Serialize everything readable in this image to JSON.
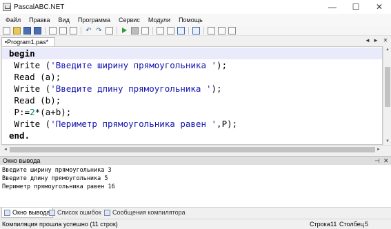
{
  "window": {
    "title": "PascalABC.NET",
    "minimize": "—",
    "maximize": "☐",
    "close": "✕"
  },
  "menu": [
    "Файл",
    "Правка",
    "Вид",
    "Программа",
    "Сервис",
    "Модули",
    "Помощь"
  ],
  "editor_tab": {
    "label": "•Program1.pas*",
    "prev": "◄",
    "next": "►",
    "close": "✕"
  },
  "code": {
    "l1_kw": "begin",
    "l2_fn": " Write (",
    "l2_str": "'Введите ширину прямоугольника '",
    "l2_end": ");",
    "l3": " Read (a);",
    "l4_fn": " Write (",
    "l4_str": "'Введите длину прямоугольника '",
    "l4_end": ");",
    "l5": " Read (b);",
    "l6_a": " P:=",
    "l6_num": "2",
    "l6_b": "*(a+b);",
    "l7_fn": " Write (",
    "l7_str": "'Периметр прямоугольника равен '",
    "l7_end": ",P);",
    "l8_kw": "end."
  },
  "output_panel": {
    "title": "Окно вывода",
    "pin": "⊣",
    "close": "✕"
  },
  "output_lines": [
    "Введите ширину прямоугольника 3",
    "Введите длину прямоугольника 5",
    "Периметр прямоугольника равен 16"
  ],
  "bottom_tabs": {
    "output": "Окно вывода",
    "errors": "Список ошибок",
    "compiler": "Сообщения компилятора"
  },
  "status": {
    "message": "Компиляция прошла успешно (11 строк)",
    "row_label": "Строка",
    "row": "11",
    "col_label": "Столбец",
    "col": "5"
  }
}
